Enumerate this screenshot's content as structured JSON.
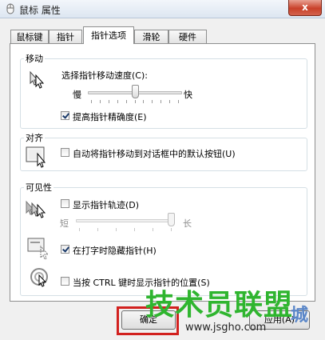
{
  "window": {
    "title": "鼠标 属性",
    "close_label": "x"
  },
  "tabs": [
    {
      "label": "鼠标键"
    },
    {
      "label": "指针"
    },
    {
      "label": "指针选项"
    },
    {
      "label": "滑轮"
    },
    {
      "label": "硬件"
    }
  ],
  "motion": {
    "group_label": "移动",
    "speed_label": "选择指针移动速度(C):",
    "slow_label": "慢",
    "fast_label": "快",
    "speed_level": 0.5,
    "precision_label": "提高指针精确度(E)",
    "precision_checked": true
  },
  "snap": {
    "group_label": "对齐",
    "snap_label": "自动将指针移动到对话框中的默认按钮(U)",
    "snap_checked": false
  },
  "visibility": {
    "group_label": "可见性",
    "trails_label": "显示指针轨迹(D)",
    "trails_checked": false,
    "short_label": "短",
    "long_label": "长",
    "trail_level": 1.0,
    "hide_label": "在打字时隐藏指针(H)",
    "hide_checked": true,
    "ctrl_label": "当按 CTRL 键时显示指针的位置(S)",
    "ctrl_checked": false
  },
  "buttons": {
    "ok_label": "确定",
    "apply_label": "应用(A)"
  },
  "watermark": {
    "brand": "技术员联盟",
    "url": "www.jsgho.com",
    "suffix": "城"
  }
}
